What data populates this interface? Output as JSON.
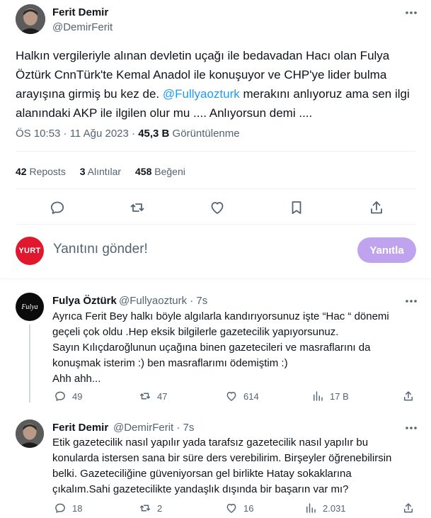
{
  "main_tweet": {
    "author_name": "Ferit Demir",
    "author_handle": "@DemirFerit",
    "text_before_mention": "Halkın vergileriyle  alınan  devletin uçağı ile bedavadan  Hacı olan  Fulya Öztürk CnnTürk'te  Kemal Anadol ile konuşuyor ve CHP'ye lider bulma arayışına girmiş bu kez de. ",
    "mention": "@Fullyaozturk",
    "text_after_mention": " merakını anlıyoruz ama sen ilgi alanındaki  AKP ile ilgilen olur mu .... Anlıyorsun demi ....",
    "timestamp": "ÖS 10:53 · 11 Ağu 2023 · ",
    "views_count": "45,3 B",
    "views_label": " Görüntülenme",
    "reposts_count": "42",
    "reposts_label": " Reposts",
    "quotes_count": "3",
    "quotes_label": " Alıntılar",
    "likes_count": "458",
    "likes_label": " Beğeni"
  },
  "compose": {
    "avatar_text": "YURT",
    "placeholder": "Yanıtını gönder!",
    "button_label": "Yanıtla"
  },
  "replies": [
    {
      "author_name": "Fulya Öztürk",
      "author_handle": "@Fullyaozturk · 7s",
      "avatar_text": "Fulya",
      "lines": [
        "Ayrıca Ferit Bey halkı böyle algılarla kandırıyorsunuz işte “Hac “ dönemi",
        "geçeli çok oldu .Hep eksik bilgilerle gazetecilik yapıyorsunuz.",
        "Sayın Kılıçdaroğlunun uçağına binen gazetecileri ve masraflarını da",
        "konuşmak isterim :) ben masraflarımı ödemiştim :)",
        "Ahh ahh..."
      ],
      "reply_count": "49",
      "repost_count": "47",
      "like_count": "614",
      "view_count": "17 B"
    },
    {
      "author_name": "Ferit Demir",
      "author_handle": "@DemirFerit · 7s",
      "lines": [
        "Etik gazetecilik nasıl yapılır yada tarafsız gazetecilik nasıl yapılır bu",
        "konularda istersen sana bir süre ders verebilirim. Birşeyler öğrenebilirsin",
        "belki. Gazeteciliğine güveniyorsan gel birlikte Hatay sokaklarına",
        "çıkalım.Sahi gazetecilikte yandaşlık dışında bir başarın var mı?"
      ],
      "reply_count": "18",
      "repost_count": "2",
      "like_count": "16",
      "view_count": "2.031"
    }
  ],
  "colors": {
    "accent": "#1d9bf0",
    "reply_button": "#bfa3ef",
    "secondary_text": "#536471",
    "divider": "#eff3f4"
  },
  "icons": [
    "more-icon",
    "reply-icon",
    "repost-icon",
    "like-icon",
    "bookmark-icon",
    "share-icon",
    "views-icon"
  ]
}
